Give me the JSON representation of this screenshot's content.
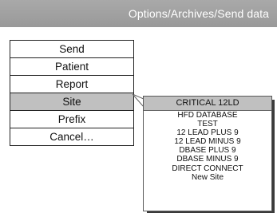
{
  "header": {
    "title": "Options/Archives/Send data"
  },
  "menu": {
    "items": [
      {
        "label": "Send",
        "selected": false
      },
      {
        "label": "Patient",
        "selected": false
      },
      {
        "label": "Report",
        "selected": false
      },
      {
        "label": "Site",
        "selected": true
      },
      {
        "label": "Prefix",
        "selected": false
      },
      {
        "label": "Cancel…",
        "selected": false
      }
    ]
  },
  "submenu": {
    "items": [
      {
        "label": "CRITICAL 12LD",
        "highlighted": true
      },
      {
        "label": "HFD DATABASE",
        "highlighted": false
      },
      {
        "label": "TEST",
        "highlighted": false
      },
      {
        "label": "12 LEAD PLUS 9",
        "highlighted": false
      },
      {
        "label": "12 LEAD MINUS 9",
        "highlighted": false
      },
      {
        "label": "DBASE PLUS 9",
        "highlighted": false
      },
      {
        "label": "DBASE MINUS 9",
        "highlighted": false
      },
      {
        "label": "DIRECT CONNECT",
        "highlighted": false
      },
      {
        "label": "New Site",
        "highlighted": false
      }
    ]
  },
  "colors": {
    "header_bg": "#a0a0a0",
    "header_text": "#ffffff",
    "selected_bg": "#c0c0c0",
    "border": "#222222"
  }
}
